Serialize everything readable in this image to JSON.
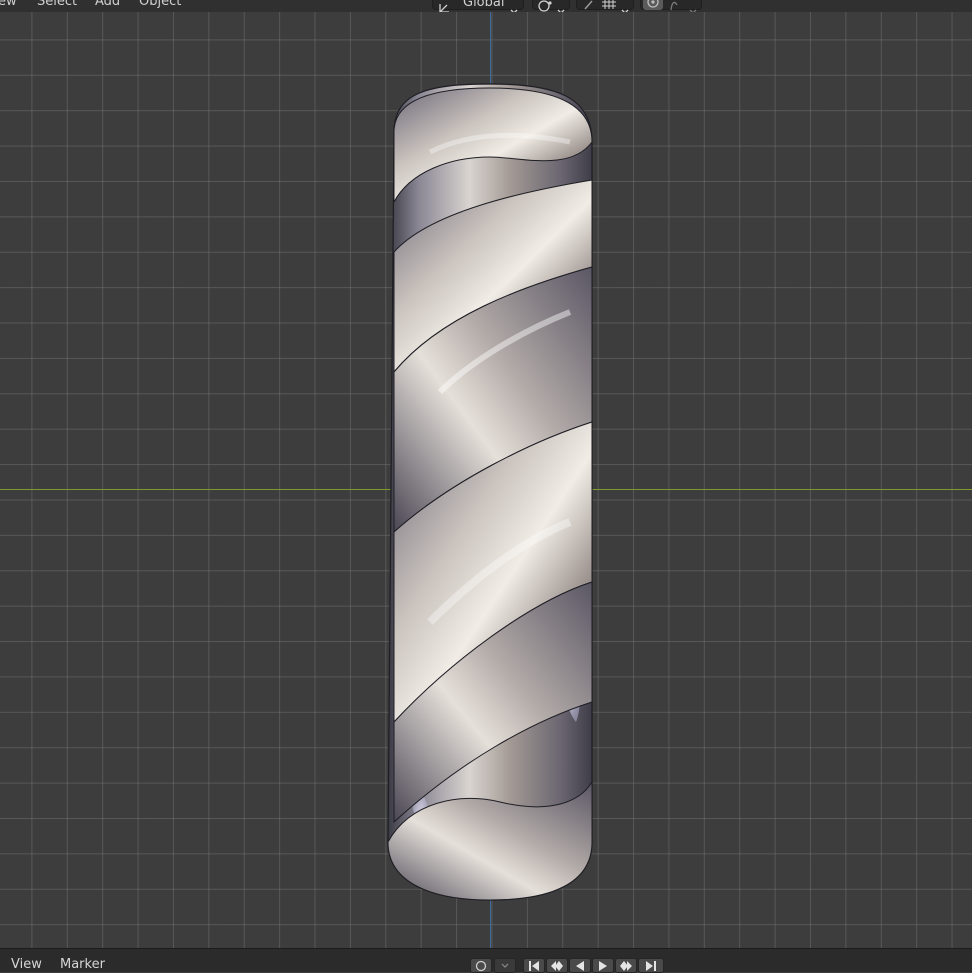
{
  "header": {
    "menus": [
      "ew",
      "Select",
      "Add",
      "Object"
    ],
    "transform_orientation": "Global"
  },
  "viewport": {
    "object": "twisted-tube-mesh",
    "axis_colors": {
      "x": "#7f9a2c",
      "y": "#3c6ba0"
    },
    "grid_color": "#5a5a5a",
    "background": "#3d3d3d"
  },
  "timeline": {
    "menus": [
      "View",
      "Marker"
    ],
    "playback_icons": [
      "jump-start-icon",
      "prev-keyframe-icon",
      "play-reverse-icon",
      "play-icon",
      "next-keyframe-icon",
      "jump-end-icon"
    ]
  }
}
